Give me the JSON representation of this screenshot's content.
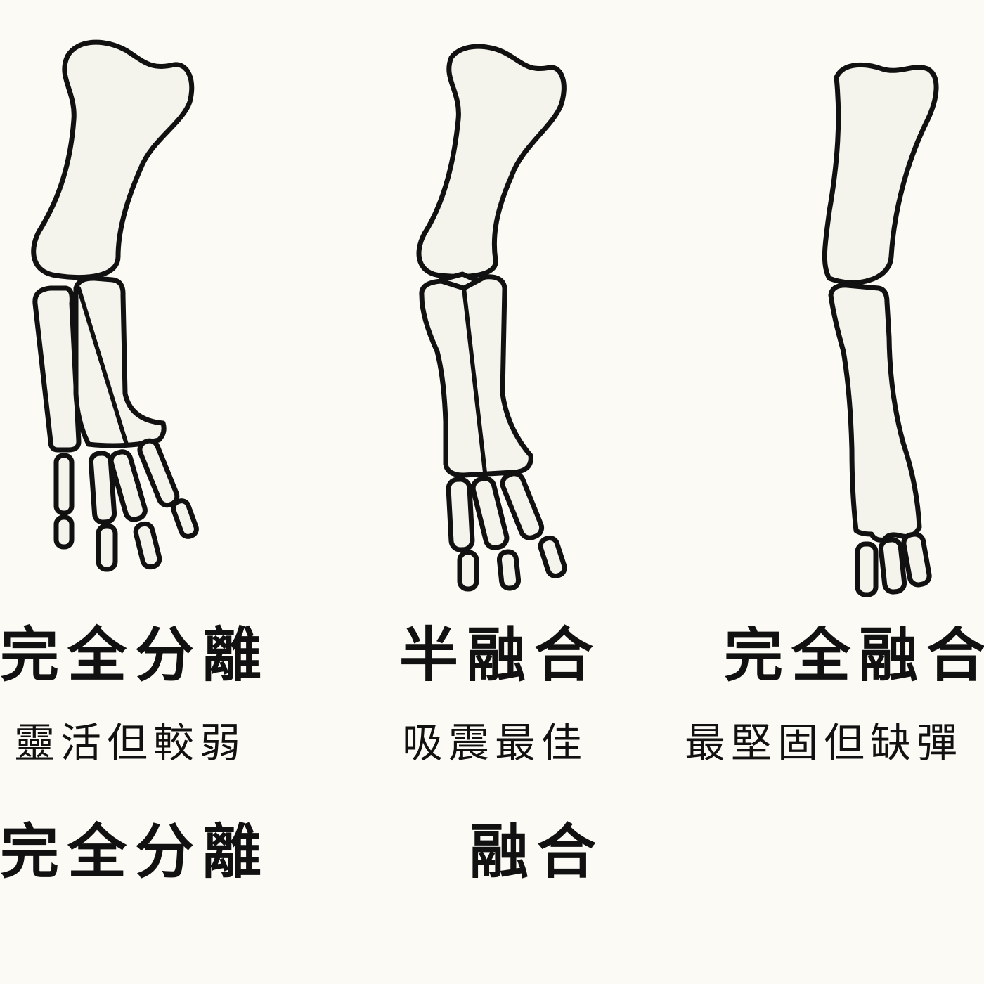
{
  "panels": [
    {
      "title": "完全分離",
      "subtitle": "靈活但較弱",
      "icon": "separated-forearm-bones-icon"
    },
    {
      "title": "半融合",
      "subtitle": "吸震最佳",
      "icon": "semi-fused-forearm-bones-icon"
    },
    {
      "title": "完全融合",
      "subtitle": "最堅固但缺彈",
      "icon": "fully-fused-forearm-bones-icon"
    }
  ],
  "bottom_row": {
    "left": "完全分離",
    "center": "融合"
  },
  "colors": {
    "background": "#fbfaf5",
    "bone_fill": "#f4f3ec",
    "outline": "#111111"
  }
}
